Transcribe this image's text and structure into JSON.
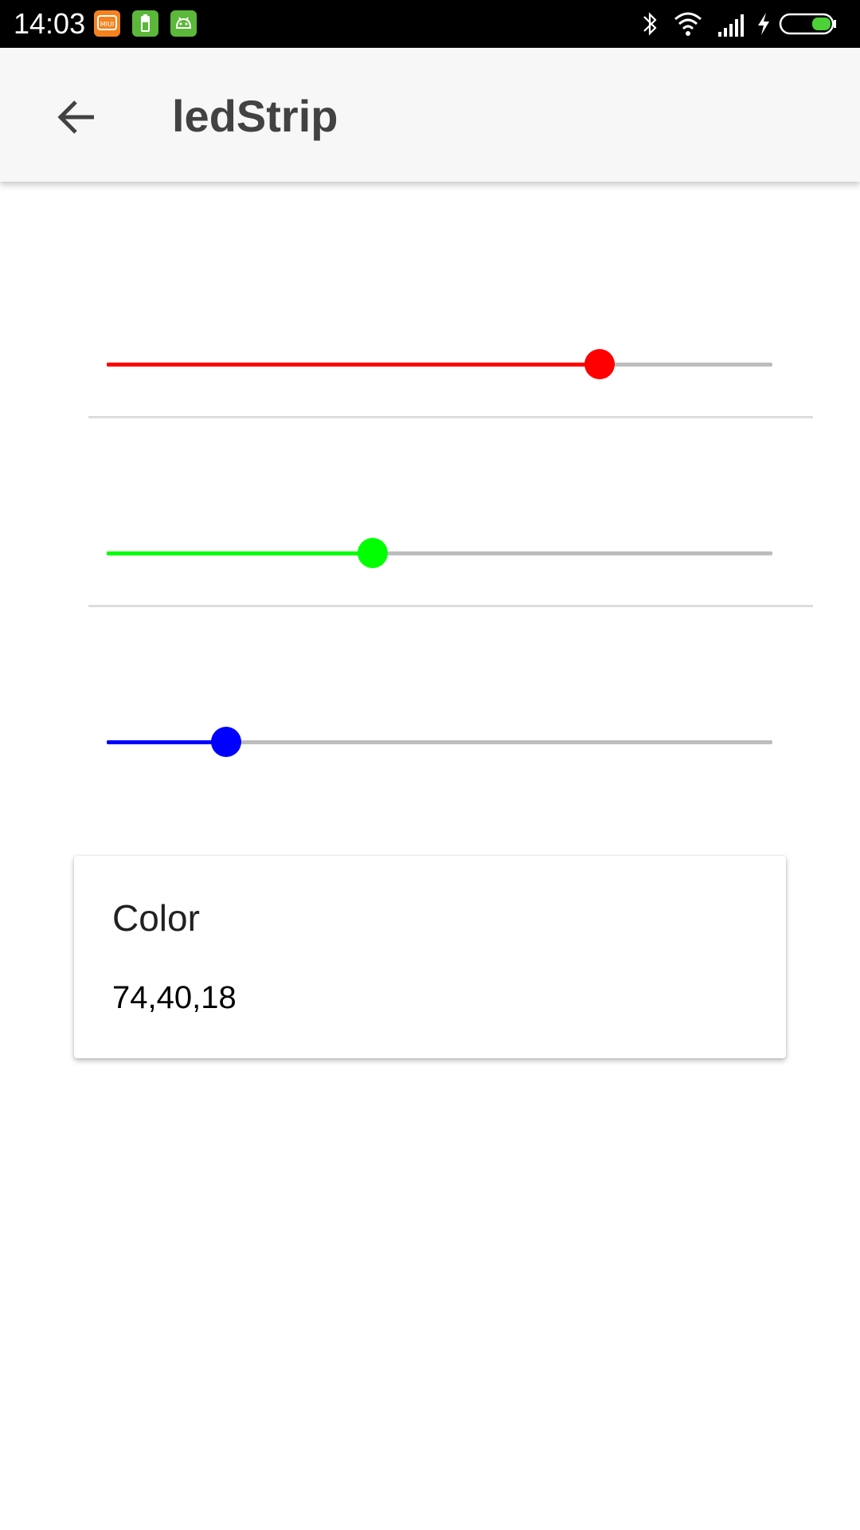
{
  "status_bar": {
    "time": "14:03",
    "notification_icons": [
      "miui-icon",
      "battery-app-icon",
      "android-icon"
    ],
    "system_icons": [
      "bluetooth-icon",
      "wifi-icon",
      "signal-icon",
      "charging-icon",
      "battery-icon"
    ]
  },
  "app_bar": {
    "title": "ledStrip",
    "back_icon": "arrow-left-icon"
  },
  "sliders": [
    {
      "name": "red",
      "color": "#ff0000",
      "value_fraction": 0.74
    },
    {
      "name": "green",
      "color": "#00ff00",
      "value_fraction": 0.4
    },
    {
      "name": "blue",
      "color": "#0000ff",
      "value_fraction": 0.18
    }
  ],
  "card": {
    "title": "Color",
    "value": "74,40,18"
  },
  "colors": {
    "status_bar_bg": "#000000",
    "app_bar_bg": "#f7f7f7",
    "title_text": "#424242",
    "track_inactive": "#bdbdbd"
  }
}
